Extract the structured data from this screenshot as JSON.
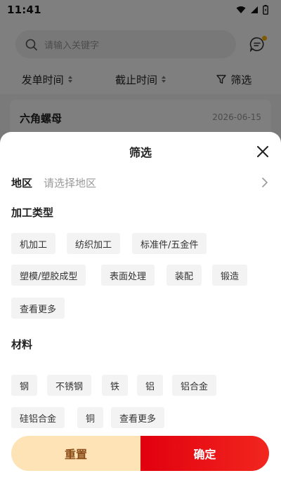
{
  "status_bar": {
    "time": "11:41"
  },
  "search": {
    "placeholder": "请输入关键字"
  },
  "sort_bar": {
    "items": [
      {
        "label": "发单时间"
      },
      {
        "label": "截止时间"
      },
      {
        "label": "筛选"
      }
    ]
  },
  "list": {
    "items": [
      {
        "title": "六角螺母",
        "date": "2026-06-15"
      }
    ]
  },
  "filter_sheet": {
    "title": "筛选",
    "region": {
      "label": "地区",
      "placeholder": "请选择地区"
    },
    "processing_type": {
      "title": "加工类型",
      "tags": [
        "机加工",
        "纺织加工",
        "标准件/五金件",
        "塑模/塑胶成型",
        "表面处理",
        "装配",
        "锻造",
        "查看更多"
      ]
    },
    "material": {
      "title": "材料",
      "tags": [
        "钢",
        "不锈钢",
        "铁",
        "铝",
        "铝合金",
        "硅铝合金",
        "铜",
        "查看更多"
      ]
    },
    "buttons": {
      "reset": "重置",
      "confirm": "确定"
    }
  },
  "colors": {
    "confirm_start": "#e1000e",
    "confirm_end": "#f2261f",
    "reset_bg": "#fde3b6",
    "reset_text": "#8a4b16",
    "notification_dot": "#ffb400"
  }
}
